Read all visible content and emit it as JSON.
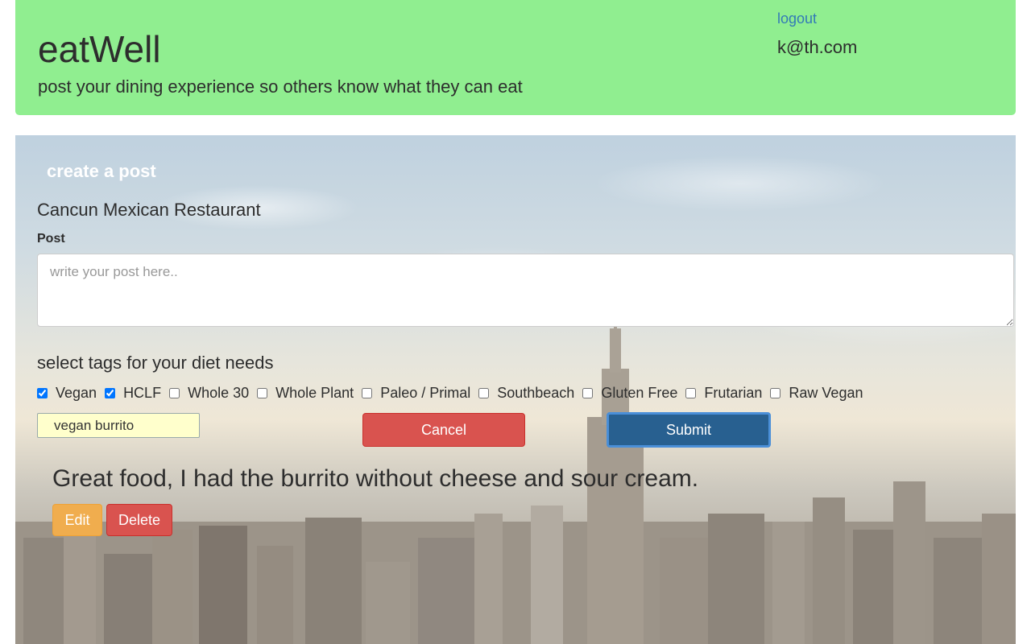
{
  "header": {
    "brand": "eatWell",
    "tagline": "post your dining experience so others know what they can eat",
    "logout_label": "logout",
    "user_email": "k@th.com"
  },
  "create_post": {
    "section_title": "create a post",
    "restaurant_name": "Cancun Mexican Restaurant",
    "post_label": "Post",
    "post_placeholder": "write your post here..",
    "post_value": "",
    "tags_title": "select tags for your diet needs",
    "tags": [
      {
        "label": "Vegan",
        "checked": true
      },
      {
        "label": "HCLF",
        "checked": true
      },
      {
        "label": "Whole 30",
        "checked": false
      },
      {
        "label": "Whole Plant",
        "checked": false
      },
      {
        "label": "Paleo / Primal",
        "checked": false
      },
      {
        "label": "Southbeach",
        "checked": false
      },
      {
        "label": "Gluten Free",
        "checked": false
      },
      {
        "label": "Frutarian",
        "checked": false
      },
      {
        "label": "Raw Vegan",
        "checked": false
      }
    ],
    "tag_input_value": "vegan burrito",
    "cancel_label": "Cancel",
    "submit_label": "Submit"
  },
  "posts": [
    {
      "text": "Great food, I had the burrito without cheese and sour cream.",
      "edit_label": "Edit",
      "delete_label": "Delete"
    }
  ],
  "colors": {
    "header_bg": "#90ee90",
    "link": "#337ab7",
    "danger": "#d9534f",
    "primary": "#286090",
    "warning": "#f0ad4e",
    "tag_input_bg": "#ffffcc"
  }
}
